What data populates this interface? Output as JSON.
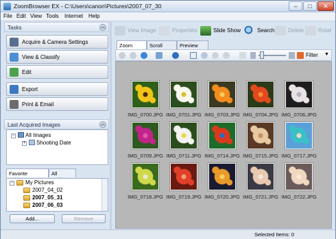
{
  "window": {
    "title": "ZoomBrowser EX - C:\\Users\\canon\\Pictures\\2007_07_30",
    "controls": [
      "–",
      "□",
      "✕"
    ]
  },
  "menu": [
    "File",
    "Edit",
    "View",
    "Tools",
    "Internet",
    "Help"
  ],
  "tasks": {
    "header": "Tasks",
    "buttons": [
      {
        "label": "Acquire & Camera Settings",
        "color": "#5a6f8f"
      },
      {
        "label": "View & Classify",
        "color": "#4c8fd4"
      },
      {
        "label": "Edit",
        "color": "#4aa24a"
      },
      {
        "label": "Export",
        "color": "#3c78c4"
      },
      {
        "label": "Print & Email",
        "color": "#6c6c6c"
      }
    ]
  },
  "last_acquired": {
    "header": "Last Acquired Images",
    "root": "All Images",
    "child": "Shooting Date"
  },
  "folders": {
    "tabs": [
      "Favorite Folders",
      "All Folders"
    ],
    "root": "My Pictures",
    "items": [
      "2007_04_02",
      "2007_05_31",
      "2007_06_03"
    ],
    "add_label": "Add...",
    "remove_label": "Remove"
  },
  "toolbar": {
    "view_image": "View Image",
    "properties": "Properties",
    "slide_show": "Slide Show",
    "search": "Search",
    "delete": "Delete",
    "rotate": "Rotat"
  },
  "mode_tabs": [
    "Zoom Mode",
    "Scroll Mode",
    "Preview Mode"
  ],
  "filter_label": "Filter",
  "images": [
    {
      "name": "IMG_0700.JPG",
      "colors": [
        "#2f5f1a",
        "#f0c419",
        "#4a2a0a"
      ]
    },
    {
      "name": "IMG_0701.JPG",
      "colors": [
        "#2c4d1f",
        "#f8f8f0",
        "#d8c02a"
      ]
    },
    {
      "name": "IMG_0703.JPG",
      "colors": [
        "#3a3a22",
        "#f28c1e",
        "#ffcc55"
      ]
    },
    {
      "name": "IMG_0704.JPG",
      "colors": [
        "#2c3a1a",
        "#e04a1c",
        "#ff8a3a"
      ]
    },
    {
      "name": "IMG_0706.JPG",
      "colors": [
        "#1d1d1d",
        "#e8e2e6",
        "#b8b0c0"
      ]
    },
    {
      "name": "IMG_0709.JPG",
      "colors": [
        "#2e5a22",
        "#c2258a",
        "#e05ab0"
      ]
    },
    {
      "name": "IMG_0711.JPG",
      "colors": [
        "#2b4d1d",
        "#f2f2ee",
        "#e8d84a"
      ]
    },
    {
      "name": "IMG_0714.JPG",
      "colors": [
        "#1f6b2a",
        "#d83a1c",
        "#2a6ad0"
      ]
    },
    {
      "name": "IMG_0715.JPG",
      "colors": [
        "#5a3a26",
        "#e8c9a2",
        "#c89060"
      ]
    },
    {
      "name": "IMG_0717.JPG",
      "colors": [
        "#5aa0d8",
        "#3cc0c8",
        "#e8dcc0"
      ]
    },
    {
      "name": "IMG_0718.JPG",
      "colors": [
        "#3a6a1e",
        "#cfd84a",
        "#e8e8d0"
      ]
    },
    {
      "name": "IMG_0719.JPG",
      "colors": [
        "#6a1a10",
        "#e0402a",
        "#f0a070"
      ]
    },
    {
      "name": "IMG_0720.JPG",
      "colors": [
        "#1a1a30",
        "#e89a2a",
        "#f8d060"
      ]
    },
    {
      "name": "IMG_0721.JPG",
      "colors": [
        "#3a3a44",
        "#e8c8b0",
        "#f0e8e0"
      ]
    },
    {
      "name": "IMG_0722.JPG",
      "colors": [
        "#6a5a5a",
        "#f0d8c0",
        "#ffe8d8"
      ]
    }
  ],
  "status": {
    "selected": "Selected Items: 0"
  }
}
